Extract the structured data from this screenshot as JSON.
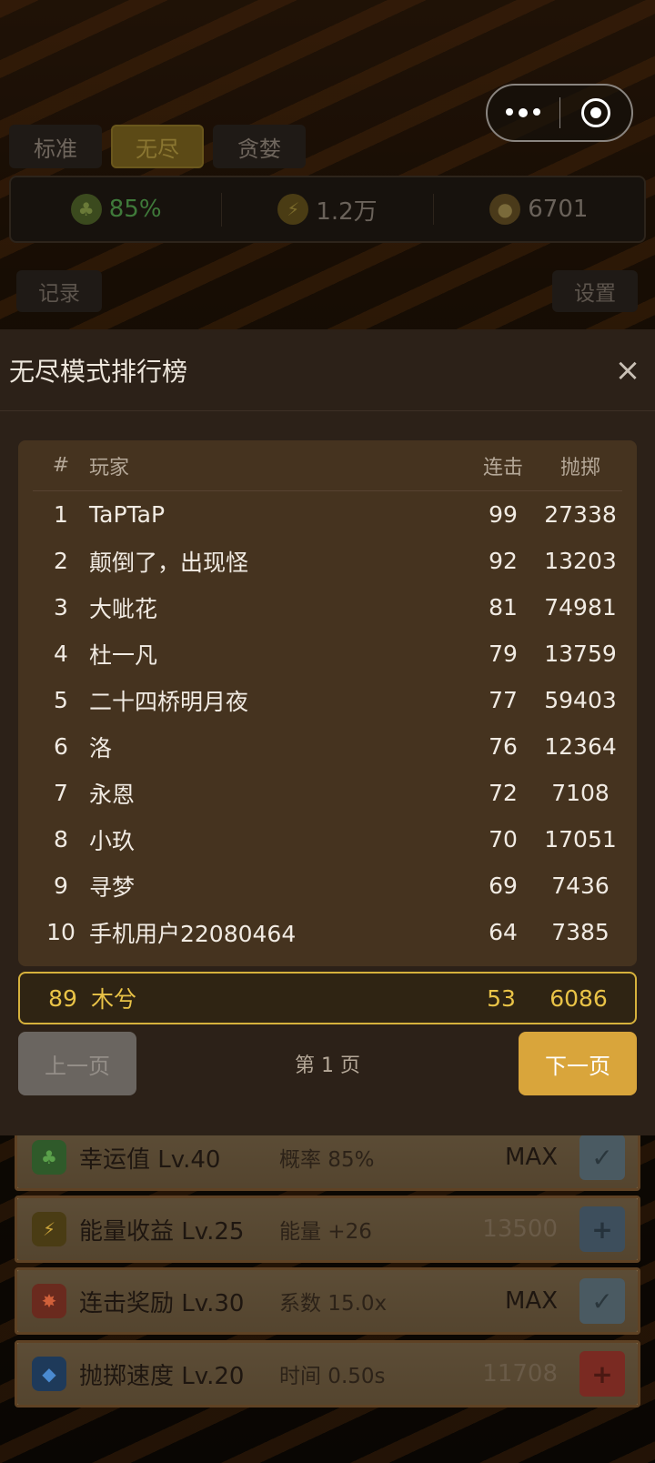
{
  "top_tabs": [
    "标准",
    "无尽",
    "贪婪"
  ],
  "stats": {
    "luck": "85%",
    "energy": "1.2万",
    "coins": "6701"
  },
  "left_button": "记录",
  "right_button": "设置",
  "modal": {
    "title": "无尽模式排行榜",
    "close_symbol": "×",
    "columns": {
      "rank": "#",
      "player": "玩家",
      "combo": "连击",
      "throw": "抛掷"
    },
    "rows": [
      {
        "rank": "1",
        "player": "TaPTaP",
        "combo": "99",
        "throw": "27338"
      },
      {
        "rank": "2",
        "player": "颠倒了，出现怪",
        "combo": "92",
        "throw": "13203"
      },
      {
        "rank": "3",
        "player": "大呲花",
        "combo": "81",
        "throw": "74981"
      },
      {
        "rank": "4",
        "player": "杜一凡",
        "combo": "79",
        "throw": "13759"
      },
      {
        "rank": "5",
        "player": "二十四桥明月夜",
        "combo": "77",
        "throw": "59403"
      },
      {
        "rank": "6",
        "player": "洛",
        "combo": "76",
        "throw": "12364"
      },
      {
        "rank": "7",
        "player": "永恩",
        "combo": "72",
        "throw": "7108"
      },
      {
        "rank": "8",
        "player": "小玖",
        "combo": "70",
        "throw": "17051"
      },
      {
        "rank": "9",
        "player": "寻梦",
        "combo": "69",
        "throw": "7436"
      },
      {
        "rank": "10",
        "player": "手机用户22080464",
        "combo": "64",
        "throw": "7385"
      }
    ],
    "my_row": {
      "rank": "89",
      "player": "木兮",
      "combo": "53",
      "throw": "6086"
    },
    "prev_label": "上一页",
    "page_label": "第 1 页",
    "next_label": "下一页"
  },
  "upgrades": [
    {
      "name": "幸运值 Lv.40",
      "effect": "概率 85%",
      "cost": "MAX",
      "action": "check",
      "icon": "clover-icon"
    },
    {
      "name": "能量收益 Lv.25",
      "effect": "能量 +26",
      "cost": "13500",
      "action": "plus",
      "icon": "shield-bolt-icon"
    },
    {
      "name": "连击奖励 Lv.30",
      "effect": "系数 15.0x",
      "cost": "MAX",
      "action": "check",
      "icon": "combo-icon"
    },
    {
      "name": "抛掷速度 Lv.20",
      "effect": "时间 0.50s",
      "cost": "11708",
      "action": "plus",
      "icon": "speed-icon"
    }
  ]
}
